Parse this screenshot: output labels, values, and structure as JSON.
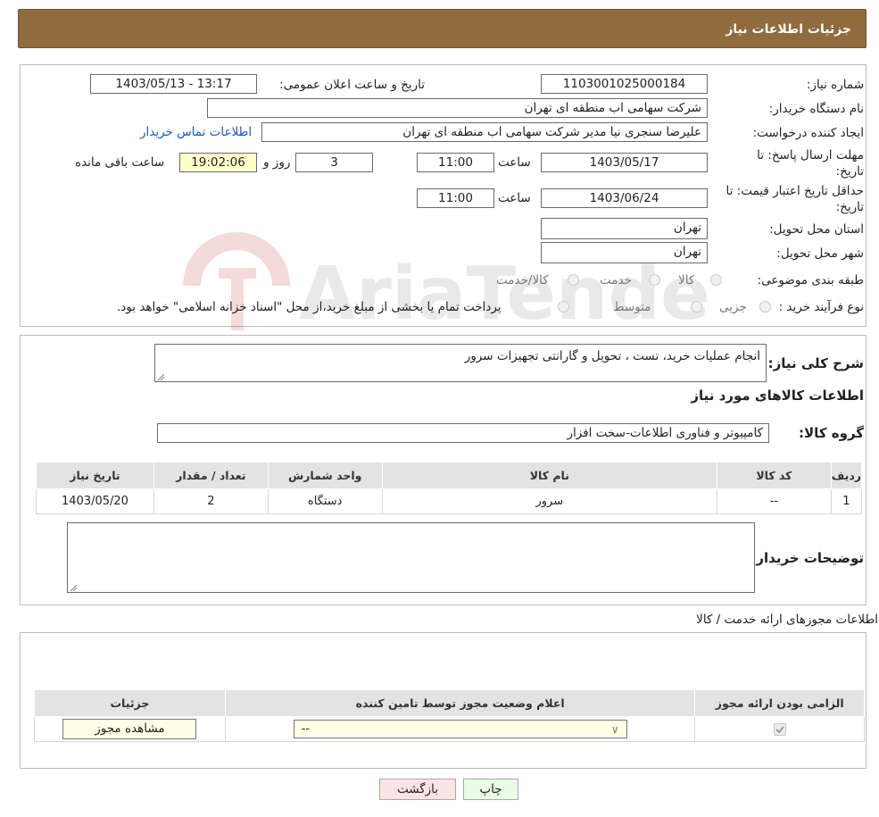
{
  "header": {
    "title": "جزئیات اطلاعات نیاز"
  },
  "watermark": {
    "text": "AriaTender.neT"
  },
  "details": {
    "need_number_label": "شماره نیاز:",
    "need_number": "1103001025000184",
    "announce_label": "تاریخ و ساعت اعلان عمومی:",
    "announce_value": "1403/05/13 - 13:17",
    "buyer_label": "نام دستگاه خریدار:",
    "buyer_value": "شرکت سهامی اب منطقه ای تهران",
    "creator_label": "ایجاد کننده درخواست:",
    "creator_value": "علیرضا سنجری نیا مدیر شرکت سهامی اب منطقه ای تهران",
    "contact_link": "اطلاعات تماس خریدار",
    "deadline_label_1": "مهلت ارسال پاسخ: تا",
    "deadline_label_2": "تاریخ:",
    "deadline_date": "1403/05/17",
    "time_label": "ساعت",
    "deadline_time": "11:00",
    "days_value": "3",
    "days_label": "روز و",
    "remaining_time": "19:02:06",
    "remaining_label": "ساعت باقی مانده",
    "validity_label_1": "حداقل تاریخ اعتبار قیمت: تا",
    "validity_label_2": "تاریخ:",
    "validity_date": "1403/06/24",
    "validity_time": "11:00",
    "province_label": "استان محل تحویل:",
    "province_value": "تهران",
    "city_label": "شهر محل تحویل:",
    "city_value": "تهران",
    "category_label": "طبقه بندی موضوعی:",
    "category_options": [
      "کالا",
      "خدمت",
      "کالا/خدمت"
    ],
    "purchase_type_label": "نوع فرآیند خرید :",
    "purchase_options": [
      "جزیی",
      "متوسط"
    ],
    "purchase_note": "پرداخت تمام یا بخشی از مبلغ خرید،از محل \"اسناد خزانه اسلامی\" خواهد بود."
  },
  "description": {
    "label": "شرح کلی نیاز:",
    "value": "انجام عملیات  خرید، تست ، تحویل و گارانتی تجهیزات سرور",
    "goods_title": "اطلاعات کالاهای مورد نیاز",
    "group_label": "گروه کالا:",
    "group_value": "کامپیوتر و فناوری اطلاعات-سخت افزار",
    "table": {
      "headers": [
        "ردیف",
        "کد کالا",
        "نام کالا",
        "واحد شمارش",
        "تعداد / مقدار",
        "تاریخ نیاز"
      ],
      "rows": [
        [
          "1",
          "--",
          "سرور",
          "دستگاه",
          "2",
          "1403/05/20"
        ]
      ]
    },
    "buyer_notes_label": "توضیحات خریدار:"
  },
  "permits": {
    "title": "اطلاعات مجوزهای ارائه خدمت / کالا",
    "headers": [
      "الزامی بودن ارائه مجوز",
      "اعلام وضعیت مجوز توسط تامین کننده",
      "جزئیات"
    ],
    "select_value": "--",
    "view_button": "مشاهده مجوز"
  },
  "footer": {
    "print_button": "چاپ",
    "back_button": "بازگشت"
  }
}
